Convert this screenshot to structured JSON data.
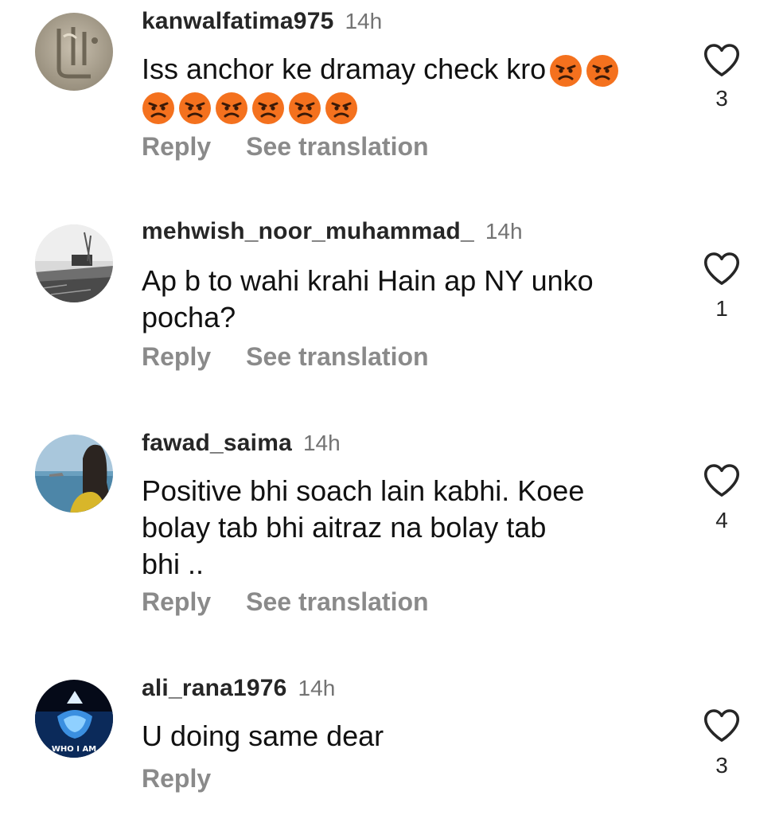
{
  "comments": [
    {
      "username": "kanwalfatima975",
      "time": "14h",
      "text": "Iss anchor ke dramay check kro",
      "emoji_count": 8,
      "emoji": "angry-face",
      "reply_label": "Reply",
      "translation_label": "See translation",
      "likes": "3"
    },
    {
      "username": "mehwish_noor_muhammad_",
      "time": "14h",
      "text_line1": "Ap b to wahi krahi Hain ap NY unko",
      "text_line2": "pocha?",
      "reply_label": "Reply",
      "translation_label": "See translation",
      "likes": "1"
    },
    {
      "username": "fawad_saima",
      "time": "14h",
      "text_line1": "Positive bhi soach lain kabhi. Koee",
      "text_line2": "bolay tab bhi aitraz na bolay tab",
      "text_line3": "bhi ..",
      "reply_label": "Reply",
      "translation_label": "See translation",
      "likes": "4"
    },
    {
      "username": "ali_rana1976",
      "time": "14h",
      "text": "U doing same dear",
      "reply_label": "Reply",
      "likes": "3",
      "avatar_caption": "WHO I AM"
    }
  ],
  "icons": {
    "like": "heart-outline-icon",
    "emoji": "angry-face"
  },
  "colors": {
    "username": "#262626",
    "meta": "#737373",
    "action": "#8a8a8a",
    "angry": "#f4711e"
  }
}
